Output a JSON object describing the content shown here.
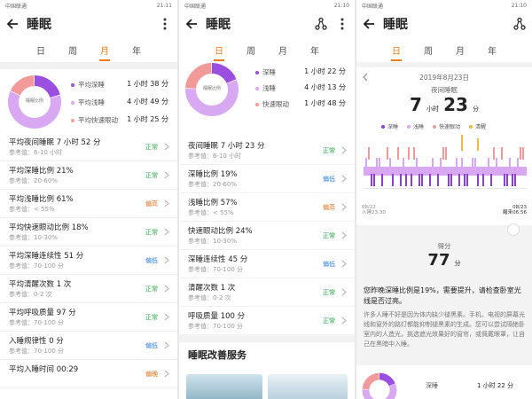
{
  "status": {
    "left1": "中国联通",
    "left2": "中国移动",
    "t1": "21:11",
    "t2": "21:10",
    "t3": "21:10",
    "bat": "76"
  },
  "app": {
    "title": "睡眠"
  },
  "tabs": [
    "日",
    "周",
    "月",
    "年"
  ],
  "p1": {
    "donut_label": "睡眠比例",
    "legend": [
      {
        "name": "平均深睡",
        "val": "1 小时 38 分",
        "color": "#9b4fe0"
      },
      {
        "name": "平均浅睡",
        "val": "4 小时 49 分",
        "color": "#d9a8f2"
      },
      {
        "name": "平均快速眼动",
        "val": "1 小时 25 分",
        "color": "#f29a9a"
      }
    ],
    "donut": [
      0.21,
      0.61,
      0.18
    ],
    "rows": [
      {
        "l": "平均夜间睡眠 7 小时 52 分",
        "r": "参考值：6-10 小时",
        "s": "正常",
        "c": "ok"
      },
      {
        "l": "平均深睡比例 21%",
        "r": "参考值：20-60%",
        "s": "正常",
        "c": "ok"
      },
      {
        "l": "平均浅睡比例 61%",
        "r": "参考值：< 55%",
        "s": "偏高",
        "c": "high"
      },
      {
        "l": "平均快速眼动比例 18%",
        "r": "参考值：10-30%",
        "s": "正常",
        "c": "ok"
      },
      {
        "l": "平均深睡连续性 51 分",
        "r": "参考值：70-100 分",
        "s": "偏低",
        "c": "low"
      },
      {
        "l": "平均清醒次数 1 次",
        "r": "参考值：0-2 次",
        "s": "正常",
        "c": "ok"
      },
      {
        "l": "平均呼吸质量 97 分",
        "r": "参考值：70-100 分",
        "s": "正常",
        "c": "ok"
      },
      {
        "l": "入睡规律性 0 分",
        "r": "参考值：70-100 分",
        "s": "偏低",
        "c": "low"
      },
      {
        "l": "平均入睡时间 00:29",
        "r": "",
        "s": "偏晚",
        "c": "high"
      }
    ]
  },
  "p2": {
    "donut_label": "睡眠比例",
    "legend": [
      {
        "name": "深睡",
        "val": "1 小时 22 分",
        "color": "#9b4fe0"
      },
      {
        "name": "浅睡",
        "val": "4 小时 13 分",
        "color": "#d9a8f2"
      },
      {
        "name": "快速眼动",
        "val": "1 小时 48 分",
        "color": "#f29a9a"
      }
    ],
    "donut": [
      0.19,
      0.57,
      0.24
    ],
    "rows": [
      {
        "l": "夜间睡眠 7 小时 23 分",
        "r": "参考值：6-10 小时",
        "s": "正常",
        "c": "ok"
      },
      {
        "l": "深睡比例 19%",
        "r": "参考值：20-60%",
        "s": "偏低",
        "c": "low"
      },
      {
        "l": "浅睡比例 57%",
        "r": "参考值：< 55%",
        "s": "偏高",
        "c": "high"
      },
      {
        "l": "快速眼动比例 24%",
        "r": "参考值：10-30%",
        "s": "正常",
        "c": "ok"
      },
      {
        "l": "深睡连续性 45 分",
        "r": "参考值：70-100 分",
        "s": "偏低",
        "c": "low"
      },
      {
        "l": "清醒次数 1 次",
        "r": "参考值：0-2 次",
        "s": "正常",
        "c": "ok"
      },
      {
        "l": "呼吸质量 100 分",
        "r": "参考值：70-100 分",
        "s": "正常",
        "c": "ok"
      }
    ],
    "service": "睡眠改善服务"
  },
  "p3": {
    "date": "2019年8月23日",
    "night_label": "夜间睡眠",
    "hours": "7",
    "hours_unit": "小时",
    "mins": "23",
    "mins_unit": "分",
    "legend": [
      "深睡",
      "浅睡",
      "快速眼动",
      "清醒"
    ],
    "legend_colors": [
      "#8a3fd6",
      "#d9a8f2",
      "#f29a9a",
      "#f5b642"
    ],
    "start_date": "08/22",
    "start": "入睡23:30",
    "end_date": "08/23",
    "end": "醒来06:56",
    "score_label": "得分",
    "score": "77",
    "score_unit": "分",
    "advice": "您昨晚深睡比例是19%，需要提升，请检查卧室光线是否过亮。",
    "tip": "许多人睡不好是因为体内缺少褪黑素。手机、电视的屏幕光线和窗外的路灯都能抑制褪黑素的生成。您可以尝试隔绝卧室内的人造光，挑选遮光效果好的窗帘，或佩戴眼罩，让自己在黑暗中入睡。",
    "mini_legend": "深睡",
    "mini_val": "1 小时 22 分"
  }
}
